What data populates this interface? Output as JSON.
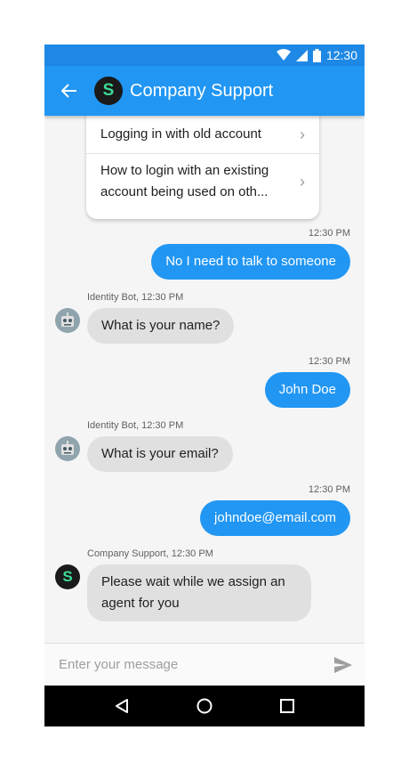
{
  "status_bar": {
    "time": "12:30"
  },
  "app_bar": {
    "avatar_letter": "S",
    "title": "Company Support"
  },
  "suggestions": [
    {
      "label": "Logging in with old account"
    },
    {
      "label": "How to login with an existing account being used on oth..."
    }
  ],
  "messages": [
    {
      "time": "12:30 PM",
      "text": "No I need to talk to someone"
    },
    {
      "sender": "Identity Bot, 12:30 PM",
      "text": "What is your name?"
    },
    {
      "time": "12:30 PM",
      "text": "John Doe"
    },
    {
      "sender": "Identity Bot, 12:30 PM",
      "text": "What is your email?"
    },
    {
      "time": "12:30 PM",
      "text": "johndoe@email.com"
    },
    {
      "sender": "Company Support, 12:30 PM",
      "avatar_letter": "S",
      "text": "Please wait while we assign an agent for you"
    }
  ],
  "composer": {
    "placeholder": "Enter your message"
  },
  "colors": {
    "primary": "#2196f3",
    "status_bar": "#1e88e5",
    "incoming_bubble": "#e0e0e0",
    "avatar_accent": "#3ddc97"
  },
  "icons": [
    "wifi-icon",
    "signal-icon",
    "battery-icon",
    "back-arrow-icon",
    "chevron-right-icon",
    "robot-icon",
    "send-icon",
    "nav-back-icon",
    "nav-home-icon",
    "nav-recents-icon"
  ]
}
